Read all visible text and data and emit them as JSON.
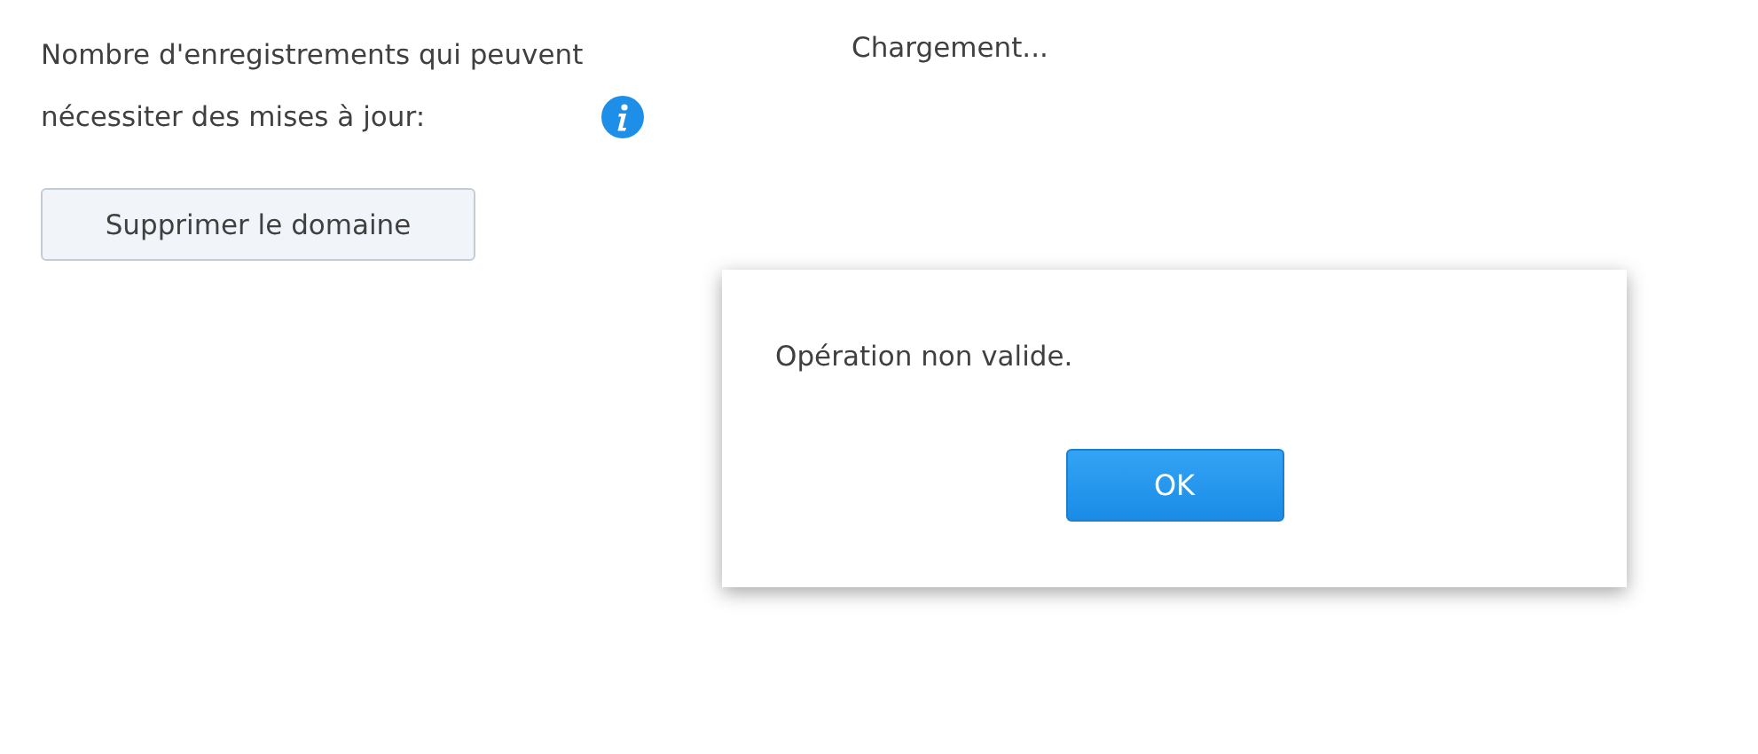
{
  "field": {
    "label": "Nombre d'enregistrements qui peuvent nécessiter des mises à jour:",
    "value": "Chargement..."
  },
  "delete_button": "Supprimer le domaine",
  "dialog": {
    "message": "Opération non valide.",
    "button": "OK"
  }
}
